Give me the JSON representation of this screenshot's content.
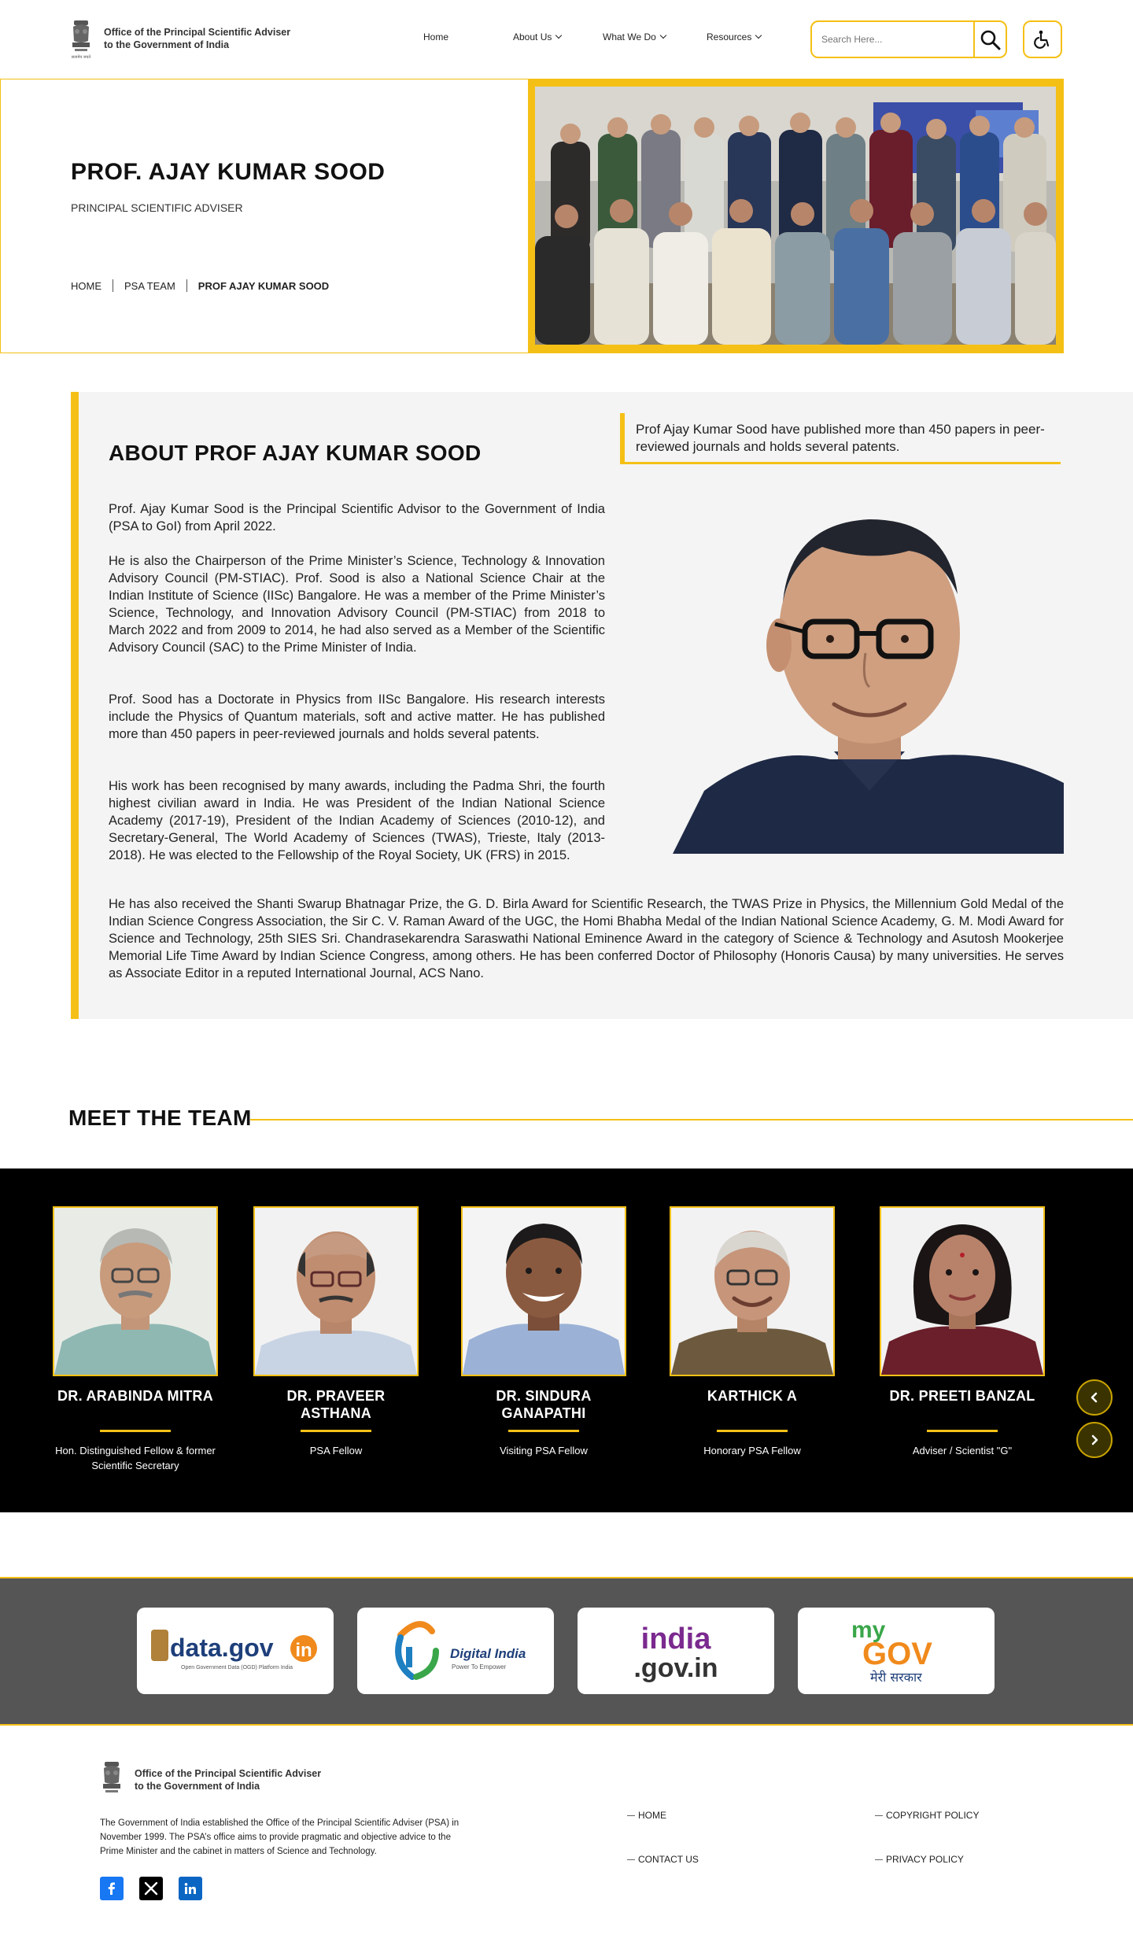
{
  "header": {
    "org_line1": "Office of the Principal Scientific Adviser",
    "org_line2": "to the Government of India",
    "emblem_caption": "सत्यमेव जयते",
    "nav": [
      {
        "label": "Home"
      },
      {
        "label": "About Us"
      },
      {
        "label": "What We Do"
      },
      {
        "label": "Resources"
      }
    ],
    "search_placeholder": "Search Here...",
    "accent_color": "#f5c016"
  },
  "hero": {
    "title": "PROF. AJAY KUMAR SOOD",
    "subtitle": "PRINCIPAL SCIENTIFIC ADVISER",
    "breadcrumb": [
      "HOME",
      "PSA TEAM",
      "PROF AJAY KUMAR SOOD"
    ]
  },
  "about": {
    "title": "ABOUT PROF AJAY KUMAR SOOD",
    "quote": "Prof Ajay Kumar Sood have published more than 450 papers in peer-reviewed journals and holds several patents.",
    "paragraphs": [
      "Prof. Ajay Kumar Sood is the Principal Scientific Advisor to the Government of India (PSA to GoI) from April 2022.",
      "He is also the Chairperson of the Prime Minister’s Science, Technology & Innovation Advisory Council (PM-STIAC). Prof. Sood is also a National Science Chair at the Indian Institute of Science (IISc) Bangalore.  He was a member of the Prime Minister’s Science, Technology, and Innovation Advisory Council (PM-STIAC) from 2018 to March 2022 and from 2009 to 2014, he had also served as a Member of the Scientific Advisory Council (SAC) to the Prime Minister of India.",
      "Prof. Sood has a Doctorate in Physics from IISc Bangalore. His research interests include the Physics of Quantum materials, soft and active matter. He has published more than 450 papers in peer-reviewed journals and holds several patents.",
      "His work has been recognised by many awards, including the Padma Shri, the fourth highest civilian award in India. He was President of the Indian National Science Academy (2017-19), President of the Indian Academy of Sciences (2010-12), and Secretary-General, The World Academy of Sciences (TWAS), Trieste, Italy (2013-2018). He was elected to the Fellowship of the Royal Society, UK (FRS) in 2015.",
      "He has also received the Shanti Swarup Bhatnagar Prize, the G. D. Birla Award for Scientific Research, the TWAS Prize in Physics, the Millennium Gold Medal of the Indian Science Congress Association, the Sir C. V. Raman Award of the UGC, the Homi Bhabha Medal of the Indian National Science Academy, G. M. Modi Award for Science and Technology, 25th SIES Sri. Chandrasekarendra Saraswathi National Eminence Award in the category of Science & Technology and  Asutosh Mookerjee Memorial Life Time Award by Indian Science Congress, among others. He has been conferred Doctor of Philosophy (Honoris Causa) by many universities. He serves as Associate Editor in a reputed International Journal, ACS Nano."
    ]
  },
  "team": {
    "title": "MEET THE TEAM",
    "members": [
      {
        "name": "DR. ARABINDA MITRA",
        "role": "Hon. Distinguished Fellow & former Scientific Secretary"
      },
      {
        "name": "DR. PRAVEER ASTHANA",
        "role": "PSA Fellow"
      },
      {
        "name": "DR. SINDURA GANAPATHI",
        "role": "Visiting PSA Fellow"
      },
      {
        "name": "KARTHICK A",
        "role": "Honorary PSA Fellow"
      },
      {
        "name": "DR. PREETI BANZAL",
        "role": "Adviser / Scientist \"G\""
      }
    ]
  },
  "partners": {
    "datagov_main": "data.gov",
    "datagov_in": "in",
    "datagov_tag": "Open Government Data (OGD) Platform India",
    "digital_main": "Digital India",
    "digital_tag": "Power To Empower",
    "india_line1": "india",
    "india_line2": ".gov.in",
    "mygov_my": "my",
    "mygov_gov": "GOV",
    "mygov_hindi": "मेरी सरकार"
  },
  "footer": {
    "org_line1": "Office of the Principal Scientific Adviser",
    "org_line2": "to the Government of India",
    "description": "The Government of India established the Office of the Principal Scientific Adviser (PSA) in November 1999. The PSA’s office aims to provide pragmatic and objective advice to the Prime Minister and the cabinet in matters of Science and Technology.",
    "links": [
      "HOME",
      "COPYRIGHT POLICY",
      "CONTACT US",
      "PRIVACY POLICY"
    ]
  }
}
